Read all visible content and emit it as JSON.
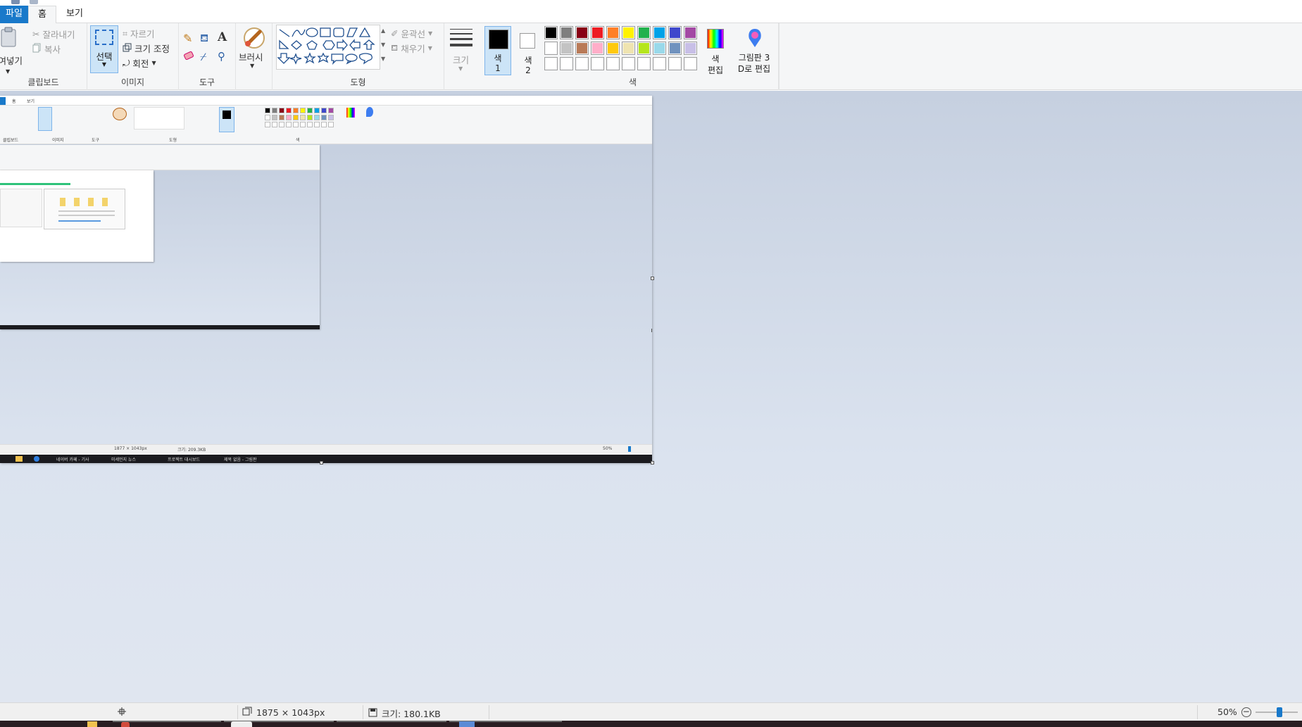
{
  "tabs": {
    "file": "파일",
    "home": "홈",
    "view": "보기"
  },
  "ribbon": {
    "clipboard": {
      "label": "클립보드",
      "paste": "붙여넣기",
      "cut": "잘라내기",
      "copy": "복사"
    },
    "image": {
      "label": "이미지",
      "select": "선택",
      "crop": "자르기",
      "resize": "크기 조정",
      "rotate": "회전"
    },
    "tools": {
      "label": "도구"
    },
    "brush": {
      "label": "브러시"
    },
    "shapes": {
      "label": "도형",
      "outline": "윤곽선",
      "fill": "채우기"
    },
    "size": {
      "label": "크기"
    },
    "color1": {
      "label": "색",
      "num": "1"
    },
    "color2": {
      "label": "색",
      "num": "2"
    },
    "colors": {
      "label": "색"
    },
    "edit_colors": {
      "line1": "색",
      "line2": "편집"
    },
    "paint3d": {
      "line1": "그림판 3",
      "line2": "D로 편집"
    }
  },
  "palette": {
    "row1": [
      "#000000",
      "#7f7f7f",
      "#880015",
      "#ed1c24",
      "#ff7f27",
      "#fff200",
      "#22b14c",
      "#00a2e8",
      "#3f48cc",
      "#a349a4"
    ],
    "row2": [
      "#ffffff",
      "#c3c3c3",
      "#b97a57",
      "#ffaec9",
      "#ffc90e",
      "#efe4b0",
      "#b5e61d",
      "#99d9ea",
      "#7092be",
      "#c8bfe7"
    ],
    "row3": [
      "#ffffff",
      "#ffffff",
      "#ffffff",
      "#ffffff",
      "#ffffff",
      "#ffffff",
      "#ffffff",
      "#ffffff",
      "#ffffff",
      "#ffffff"
    ]
  },
  "nested": {
    "tabs": [
      "홈",
      "보기"
    ],
    "clipboard": "클립보드",
    "image": "이미지",
    "tools": "도구",
    "shapes": "도형",
    "colors": "색",
    "dims": "1877 × 1043px",
    "size": "크기: 209.3KB",
    "zoom": "50%",
    "taskbar_apps": [
      "네이버 카페 - 기사",
      "미세먼지 뉴스",
      "프로젝트 대시보드",
      "제목 없음 - 그림판"
    ]
  },
  "status": {
    "dimensions": "1875 × 1043px",
    "filesize": "크기: 180.1KB",
    "zoom": "50%"
  }
}
